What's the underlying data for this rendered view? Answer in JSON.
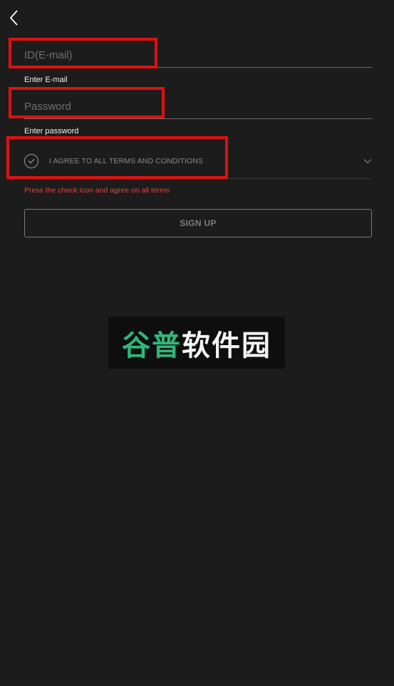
{
  "nav": {
    "back_icon": "chevron-left-icon"
  },
  "form": {
    "email": {
      "placeholder": "ID(E-mail)",
      "value": "",
      "helper": "Enter E-mail"
    },
    "password": {
      "placeholder": "Password",
      "value": "",
      "helper": "Enter password"
    },
    "terms": {
      "label": "I AGREE TO ALL TERMS AND CONDITIONS",
      "checked": false,
      "check_icon": "check-circle-icon",
      "expand_icon": "chevron-down-icon"
    },
    "error": "Press the check icon and agree on all terms",
    "signup_label": "SIGN UP"
  },
  "watermark": {
    "text_part1": "谷普",
    "text_part2": "软件园",
    "color_part1": "#2fb77a",
    "color_part2": "#f4f4f4"
  },
  "colors": {
    "background": "#1c1c1c",
    "error": "#e0443f",
    "highlight": "#e01010"
  }
}
